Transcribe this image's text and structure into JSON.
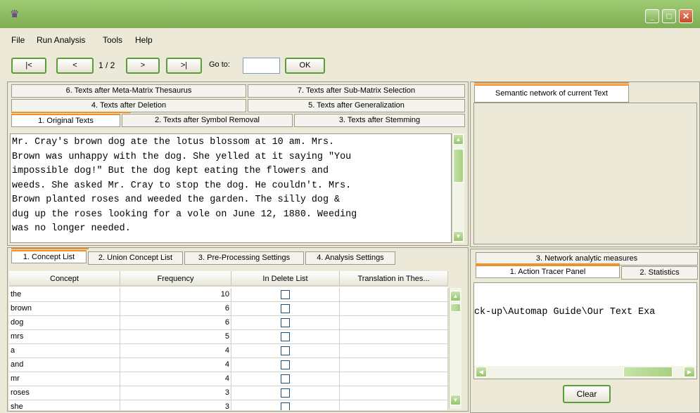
{
  "menu": [
    "File",
    "Run Analysis",
    "Tools",
    "Help"
  ],
  "toolbar": {
    "first_label": "|<",
    "prev_label": "<",
    "page": "1 / 2",
    "next_label": ">",
    "last_label": ">|",
    "goto_label": "Go to:",
    "goto_value": "",
    "ok_label": "OK"
  },
  "text_tabs": {
    "row1": [
      "6. Texts after Meta-Matrix Thesaurus",
      "7. Texts after Sub-Matrix Selection"
    ],
    "row2": [
      "4. Texts after Deletion",
      "5. Texts after Generalization"
    ],
    "row3": [
      "1. Original Texts",
      "2. Texts after Symbol Removal",
      "3. Texts after Stemming"
    ],
    "active": "1. Original Texts"
  },
  "original_text_lines": [
    "Mr. Cray's brown dog ate the lotus blossom at 10 am. Mrs.",
    "Brown was unhappy with the dog. She yelled at it saying \"You",
    "impossible dog!\" But the dog kept eating the flowers and",
    "weeds. She asked Mr. Cray to stop the dog. He couldn't. Mrs.",
    "Brown planted roses and weeded the garden. The silly dog &",
    "dug up the roses looking for a vole on June 12, 1880. Weeding",
    "was no longer needed."
  ],
  "bottom_tabs": [
    "1. Concept List",
    "2. Union Concept List",
    "3. Pre-Processing Settings",
    "4. Analysis Settings"
  ],
  "concept_table": {
    "columns": [
      "Concept",
      "Frequency",
      "In Delete List",
      "Translation in Thes..."
    ],
    "rows": [
      {
        "concept": "the",
        "frequency": "10",
        "delete": false
      },
      {
        "concept": "brown",
        "frequency": "6",
        "delete": false
      },
      {
        "concept": "dog",
        "frequency": "6",
        "delete": false
      },
      {
        "concept": "mrs",
        "frequency": "5",
        "delete": false
      },
      {
        "concept": "a",
        "frequency": "4",
        "delete": false
      },
      {
        "concept": "and",
        "frequency": "4",
        "delete": false
      },
      {
        "concept": "mr",
        "frequency": "4",
        "delete": false
      },
      {
        "concept": "roses",
        "frequency": "3",
        "delete": false
      },
      {
        "concept": "she",
        "frequency": "3",
        "delete": false
      }
    ]
  },
  "right_top": {
    "tab": "Semantic network of current Text"
  },
  "right_bottom": {
    "tab_row1": "3. Network analytic measures",
    "tabs": [
      "1. Action Tracer Panel",
      "2. Statistics"
    ],
    "tracer_text": "ck-up\\Automap Guide\\Our Text Exa",
    "clear_label": "Clear"
  },
  "colors": {
    "accent": "#f0902c",
    "titlebar": "#8cbc62",
    "button_border": "#5a9e3a"
  }
}
